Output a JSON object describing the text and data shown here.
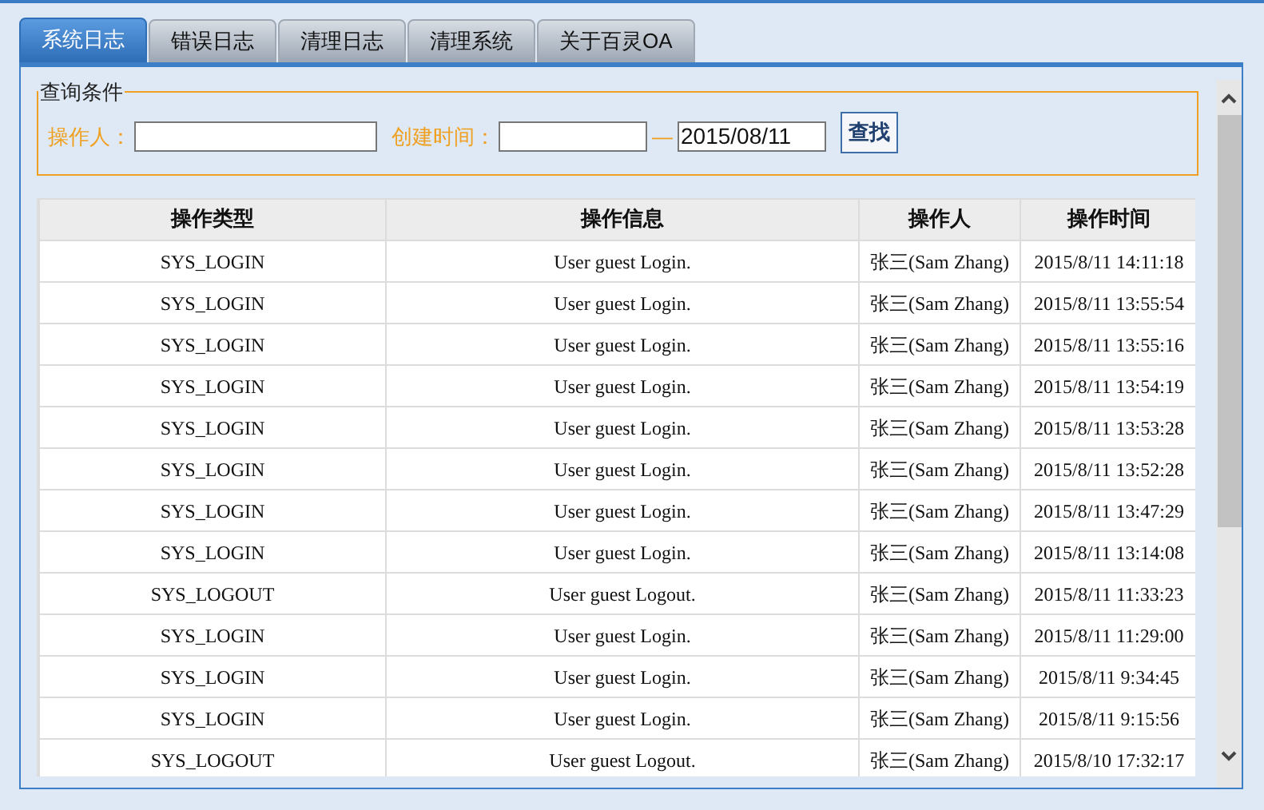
{
  "tabs": [
    {
      "label": "系统日志",
      "selected": true
    },
    {
      "label": "错误日志",
      "selected": false
    },
    {
      "label": "清理日志",
      "selected": false
    },
    {
      "label": "清理系统",
      "selected": false
    },
    {
      "label": "关于百灵OA",
      "selected": false
    }
  ],
  "query": {
    "legend": "查询条件",
    "operator_label": "操作人：",
    "time_label": "创建时间：",
    "separator": "—",
    "time_to": "2015/08/11",
    "search_button": "查找"
  },
  "table": {
    "columns": [
      "操作类型",
      "操作信息",
      "操作人",
      "操作时间"
    ],
    "rows": [
      [
        "SYS_LOGIN",
        "User guest Login.",
        "张三(Sam Zhang)",
        "2015/8/11 14:11:18"
      ],
      [
        "SYS_LOGIN",
        "User guest Login.",
        "张三(Sam Zhang)",
        "2015/8/11 13:55:54"
      ],
      [
        "SYS_LOGIN",
        "User guest Login.",
        "张三(Sam Zhang)",
        "2015/8/11 13:55:16"
      ],
      [
        "SYS_LOGIN",
        "User guest Login.",
        "张三(Sam Zhang)",
        "2015/8/11 13:54:19"
      ],
      [
        "SYS_LOGIN",
        "User guest Login.",
        "张三(Sam Zhang)",
        "2015/8/11 13:53:28"
      ],
      [
        "SYS_LOGIN",
        "User guest Login.",
        "张三(Sam Zhang)",
        "2015/8/11 13:52:28"
      ],
      [
        "SYS_LOGIN",
        "User guest Login.",
        "张三(Sam Zhang)",
        "2015/8/11 13:47:29"
      ],
      [
        "SYS_LOGIN",
        "User guest Login.",
        "张三(Sam Zhang)",
        "2015/8/11 13:14:08"
      ],
      [
        "SYS_LOGOUT",
        "User guest Logout.",
        "张三(Sam Zhang)",
        "2015/8/11 11:33:23"
      ],
      [
        "SYS_LOGIN",
        "User guest Login.",
        "张三(Sam Zhang)",
        "2015/8/11 11:29:00"
      ],
      [
        "SYS_LOGIN",
        "User guest Login.",
        "张三(Sam Zhang)",
        "2015/8/11 9:34:45"
      ],
      [
        "SYS_LOGIN",
        "User guest Login.",
        "张三(Sam Zhang)",
        "2015/8/11 9:15:56"
      ],
      [
        "SYS_LOGOUT",
        "User guest Logout.",
        "张三(Sam Zhang)",
        "2015/8/10 17:32:17"
      ]
    ]
  }
}
